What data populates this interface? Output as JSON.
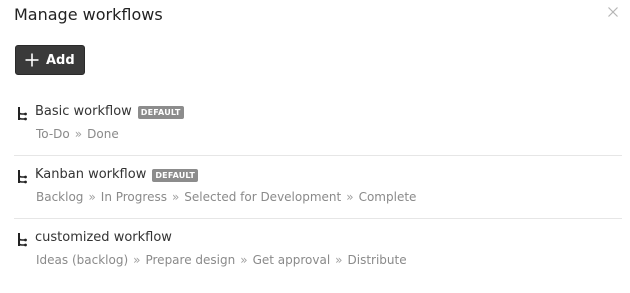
{
  "dialog": {
    "title": "Manage workflows",
    "close_icon": "close-icon"
  },
  "toolbar": {
    "add_label": "Add",
    "add_icon": "plus-icon"
  },
  "separator_glyph": "»",
  "workflows": [
    {
      "name": "Basic workflow",
      "badge": "DEFAULT",
      "steps": [
        "To-Do",
        "Done"
      ]
    },
    {
      "name": "Kanban workflow",
      "badge": "DEFAULT",
      "steps": [
        "Backlog",
        "In Progress",
        "Selected for Development",
        "Complete"
      ]
    },
    {
      "name": "customized workflow",
      "badge": "",
      "steps": [
        "Ideas (backlog)",
        "Prepare design",
        "Get approval",
        "Distribute"
      ]
    }
  ],
  "colors": {
    "button_bg": "#3a3a3a",
    "badge_bg": "#8c8c8c",
    "step_text": "#8a8a8a",
    "divider": "#e6e6e6"
  }
}
